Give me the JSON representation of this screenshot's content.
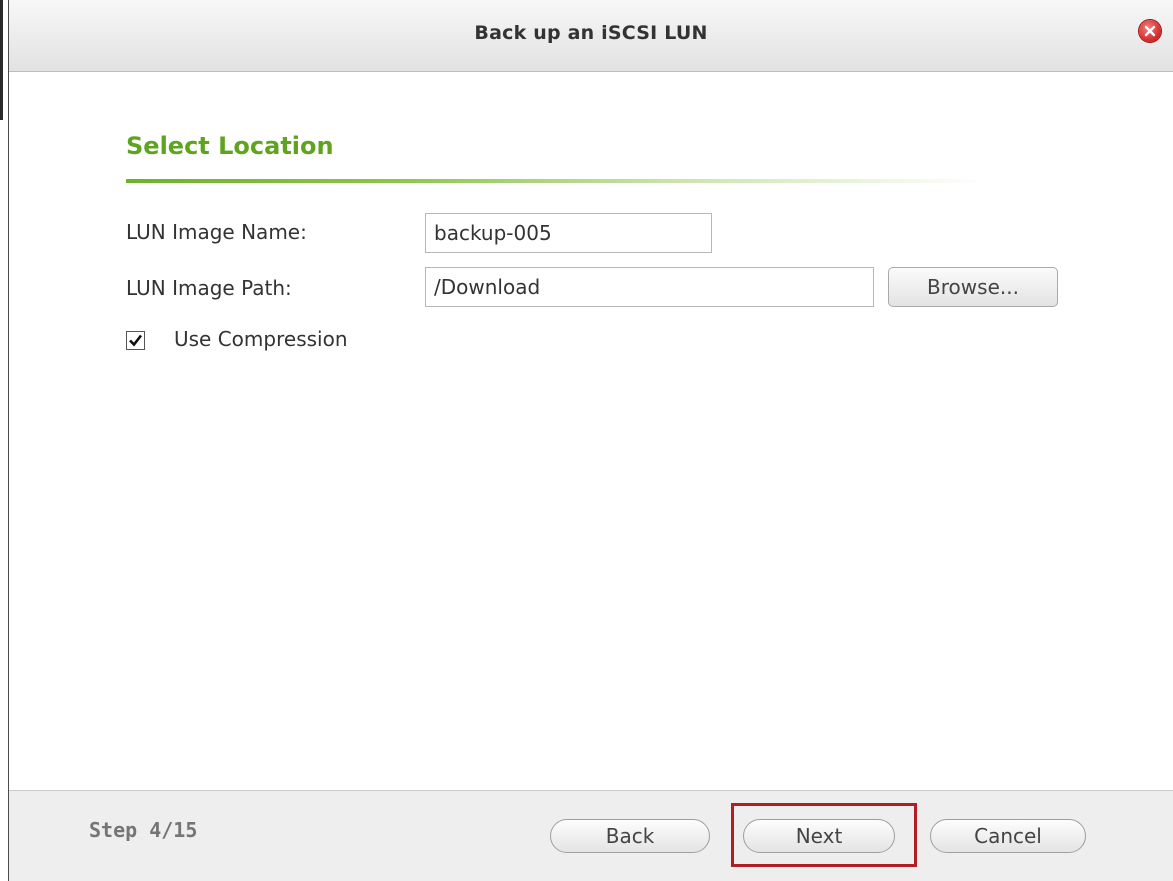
{
  "dialog": {
    "title": "Back up an iSCSI LUN",
    "close_icon": "close-icon"
  },
  "section": {
    "title": "Select Location"
  },
  "form": {
    "lun_image_name_label": "LUN Image Name:",
    "lun_image_name_value": "backup-005",
    "lun_image_path_label": "LUN Image Path:",
    "lun_image_path_value": "/Download",
    "browse_label": "Browse...",
    "use_compression_label": "Use Compression",
    "use_compression_checked": true
  },
  "footer": {
    "step_text": "Step 4/15",
    "back_label": "Back",
    "next_label": "Next",
    "cancel_label": "Cancel"
  },
  "colors": {
    "accent_green": "#5ea41f",
    "highlight_red": "#b11f23",
    "close_red": "#d22727"
  }
}
